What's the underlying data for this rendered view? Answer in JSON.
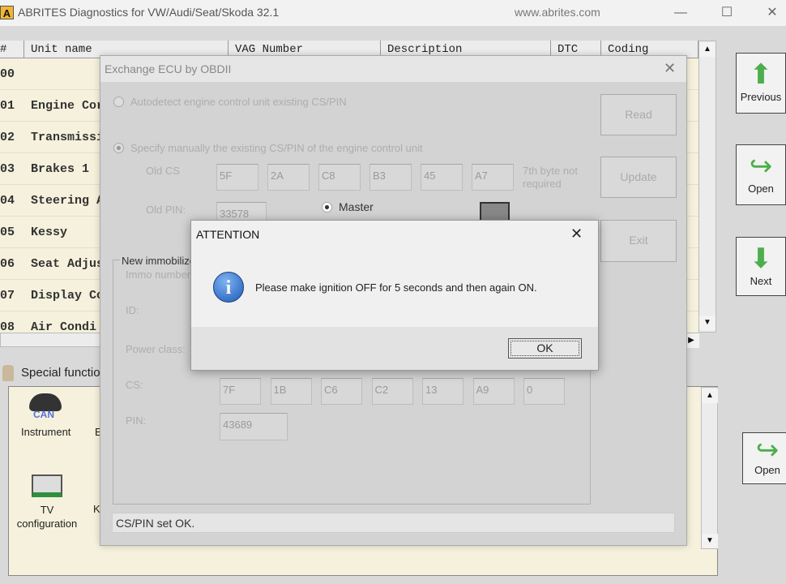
{
  "window": {
    "title": "ABRITES Diagnostics for VW/Audi/Seat/Skoda 32.1",
    "logo": "A",
    "url": "www.abrites.com",
    "minimize": "—",
    "maximize": "☐",
    "close": "✕"
  },
  "table": {
    "columns": [
      "#",
      "Unit name",
      "VAG Number",
      "Description",
      "DTC",
      "Coding"
    ],
    "rows": [
      {
        "num": "00",
        "name": ""
      },
      {
        "num": "01",
        "name": "Engine Cor"
      },
      {
        "num": "02",
        "name": "Transmissi"
      },
      {
        "num": "03",
        "name": "Brakes 1"
      },
      {
        "num": "04",
        "name": "Steering A"
      },
      {
        "num": "05",
        "name": "Kessy"
      },
      {
        "num": "06",
        "name": "Seat Adjus"
      },
      {
        "num": "07",
        "name": "Display Co"
      },
      {
        "num": "08",
        "name": "Air Condi"
      }
    ]
  },
  "nav": {
    "previous": "Previous",
    "open": "Open",
    "next": "Next",
    "open2": "Open"
  },
  "special": {
    "label": "Special functio",
    "items": [
      {
        "badge": "CAN",
        "label": "Instrument"
      },
      {
        "label": "TV configuration"
      }
    ],
    "cut_labels": [
      "E",
      "K"
    ]
  },
  "ecu_dialog": {
    "title": "Exchange ECU by OBDII",
    "close": "✕",
    "autodetect": "Autodetect engine control unit existing CS/PIN",
    "manual": "Specify manually the existing CS/PIN of the engine control unit",
    "old_cs_label": "Old CS",
    "old_cs": [
      "5F",
      "2A",
      "C8",
      "B3",
      "45",
      "A7"
    ],
    "seventh_note": "7th byte not required",
    "old_pin_label": "Old PIN:",
    "old_pin": "33578",
    "master_label": "Master",
    "read": "Read",
    "update": "Update",
    "exit": "Exit",
    "group_label": "New immobilize",
    "immo_label": "Immo number",
    "id_label": "ID:",
    "power_label": "Power class:",
    "cs_label": "CS:",
    "cs": [
      "7F",
      "1B",
      "C6",
      "C2",
      "13",
      "A9",
      "0"
    ],
    "pin_label": "PIN:",
    "pin": "43689",
    "status": "CS/PIN set OK."
  },
  "attention": {
    "title": "ATTENTION",
    "close": "✕",
    "message": "Please make ignition OFF for 5 seconds and then again ON.",
    "ok": "OK"
  }
}
